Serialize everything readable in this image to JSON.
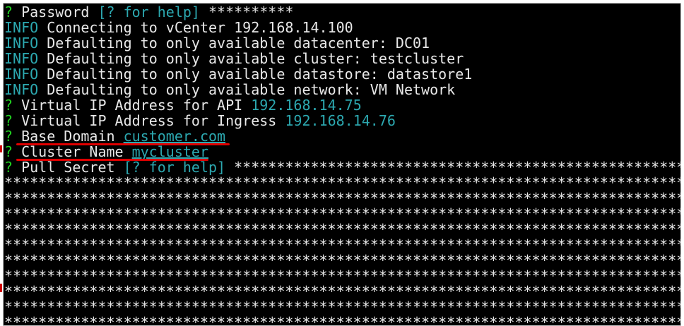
{
  "terminal": {
    "lines": {
      "password": {
        "prompt": "?",
        "label": "Password",
        "hint": "[? for help]",
        "value": "**********"
      },
      "info1": {
        "tag": "INFO",
        "text": "Connecting to vCenter 192.168.14.100"
      },
      "info2": {
        "tag": "INFO",
        "text": "Defaulting to only available datacenter: DC01"
      },
      "info3": {
        "tag": "INFO",
        "text": "Defaulting to only available cluster: testcluster"
      },
      "info4": {
        "tag": "INFO",
        "text": "Defaulting to only available datastore: datastore1"
      },
      "info5": {
        "tag": "INFO",
        "text": "Defaulting to only available network: VM Network"
      },
      "vip_api": {
        "prompt": "?",
        "label": "Virtual IP Address for API",
        "value": "192.168.14.75"
      },
      "vip_ingress": {
        "prompt": "?",
        "label": "Virtual IP Address for Ingress",
        "value": "192.168.14.76"
      },
      "base_domain": {
        "prompt": "?",
        "label": "Base Domain",
        "value": "customer.com"
      },
      "cluster_name": {
        "prompt": "?",
        "label": "Cluster Name",
        "value": "mycluster"
      },
      "pull_secret": {
        "prompt": "?",
        "label": "Pull Secret",
        "hint": "[? for help]",
        "value": "**************************************************************************************"
      }
    },
    "masked_rows": [
      "********************************************************************************",
      "********************************************************************************",
      "********************************************************************************",
      "********************************************************************************",
      "********************************************************************************",
      "********************************************************************************",
      "********************************************************************************",
      "********************************************************************************",
      "********************************************************************************",
      "********************************************************************************"
    ]
  },
  "colors": {
    "prompt": "#20d020",
    "info": "#2ca8b0",
    "text": "#e8e8e8",
    "background": "#000000",
    "annotation": "#e00000"
  }
}
